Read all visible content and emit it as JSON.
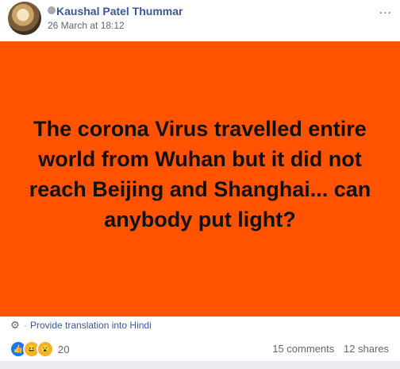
{
  "post": {
    "author": "Kaushal Patel Thummar",
    "timestamp": "26 March at 18:12",
    "menu": "...",
    "text": "The corona Virus travelled entire world from Wuhan but it did not reach Beijing and Shanghai... can anybody put light?",
    "background_color": "#ff5300"
  },
  "translation": {
    "separator": "·",
    "link": "Provide translation into Hindi"
  },
  "footer": {
    "reaction_icons": [
      "like-icon",
      "haha-icon",
      "wow-icon"
    ],
    "reaction_count": "20",
    "comments": "15 comments",
    "shares": "12 shares"
  }
}
